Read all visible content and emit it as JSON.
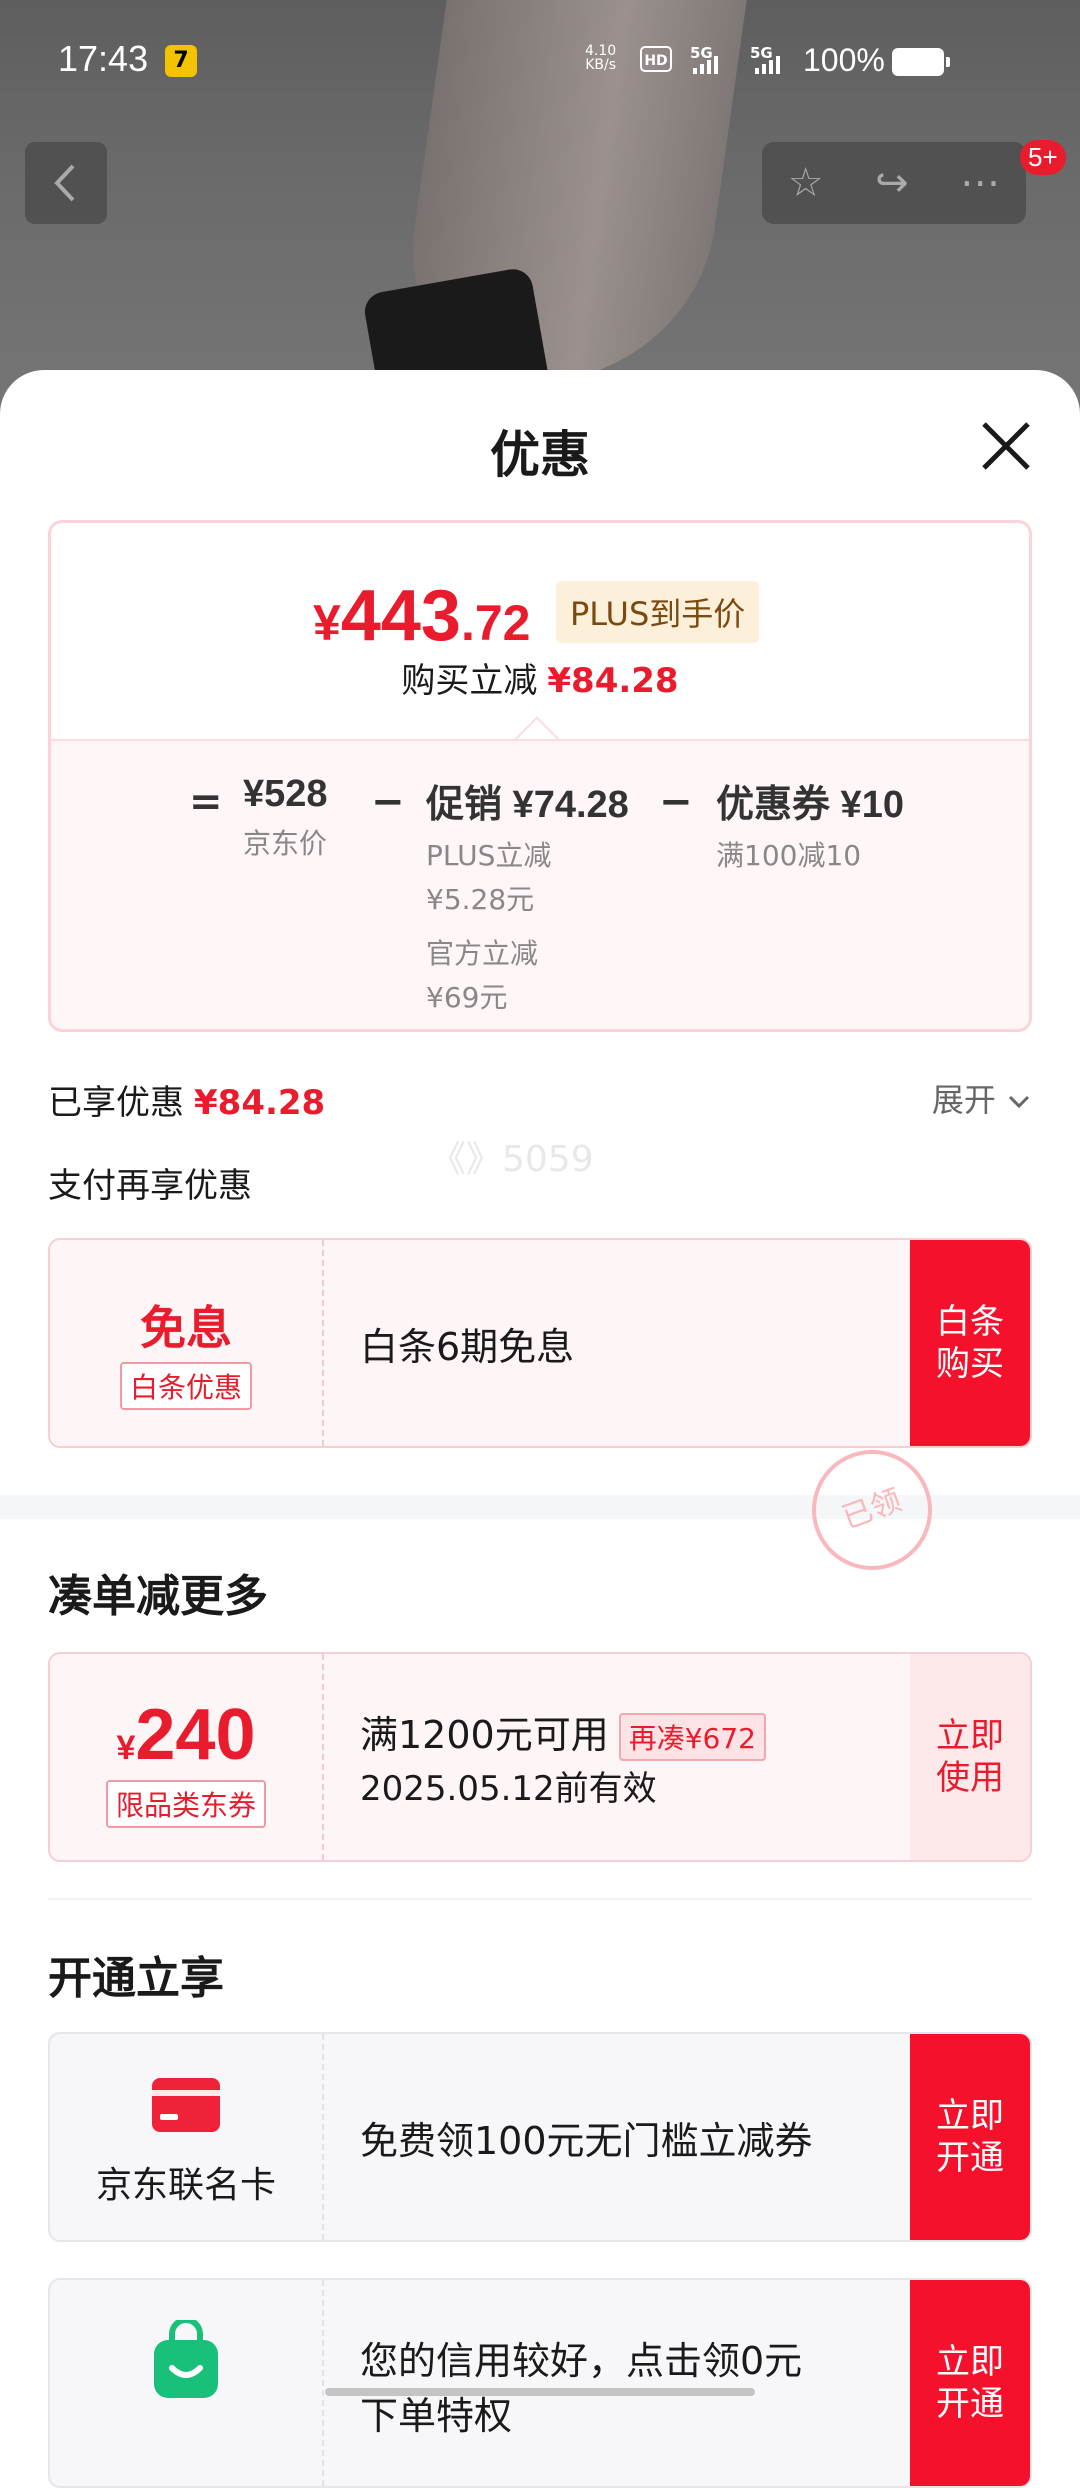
{
  "status_bar": {
    "time": "17:43",
    "app_badge": "7",
    "net_speed_value": "4.10",
    "net_speed_unit": "KB/s",
    "hd_label": "HD",
    "sig1": "5G",
    "sig2": "5G",
    "battery": "100%"
  },
  "nav": {
    "notification_count": "5+",
    "icons": [
      "chevron-left-icon",
      "star-icon",
      "share-icon",
      "more-icon"
    ]
  },
  "sheet": {
    "title": "优惠",
    "price": {
      "currency": "¥",
      "integer": "443",
      "decimal": ".72",
      "tag": "PLUS到手价",
      "reduce_label": "购买立减",
      "reduce_amount": "¥84.28"
    },
    "breakdown": {
      "eq": "=",
      "minus": "−",
      "jd_price": "¥528",
      "jd_price_label": "京东价",
      "promo": "促销 ¥74.28",
      "promo_detail1": "PLUS立减",
      "promo_detail1_val": "¥5.28元",
      "promo_detail2": "官方立减",
      "promo_detail2_val": "¥69元",
      "coupon": "优惠券 ¥10",
      "coupon_detail": "满100减10"
    },
    "enjoyed_label": "已享优惠",
    "enjoyed_amount": "¥84.28",
    "expand": "展开",
    "watermark": "《》5059",
    "pay_title": "支付再享优惠",
    "baitiao": {
      "big": "免息",
      "tag": "白条优惠",
      "desc": "白条6期免息",
      "button": "白条\n购买"
    },
    "section_combine": "凑单减更多",
    "coupon_card": {
      "currency": "¥",
      "amount": "240",
      "tag": "限品类东券",
      "line1": "满1200元可用",
      "combine_tag": "再凑¥672",
      "line2": "2025.05.12前有效",
      "button": "立即\n使用",
      "stamp": "已领"
    },
    "section_open": "开通立享",
    "jd_card": {
      "name": "京东联名卡",
      "desc": "免费领100元无门槛立减券",
      "button": "立即\n开通"
    },
    "credit_card": {
      "desc_line1": "您的信用较好，点击领0元",
      "desc_line2": "下单特权",
      "button": "立即\n开通"
    }
  },
  "colors": {
    "accent_red": "#e81c2c",
    "button_red": "#f5112b",
    "plus_tag_bg": "#fdf0da"
  }
}
